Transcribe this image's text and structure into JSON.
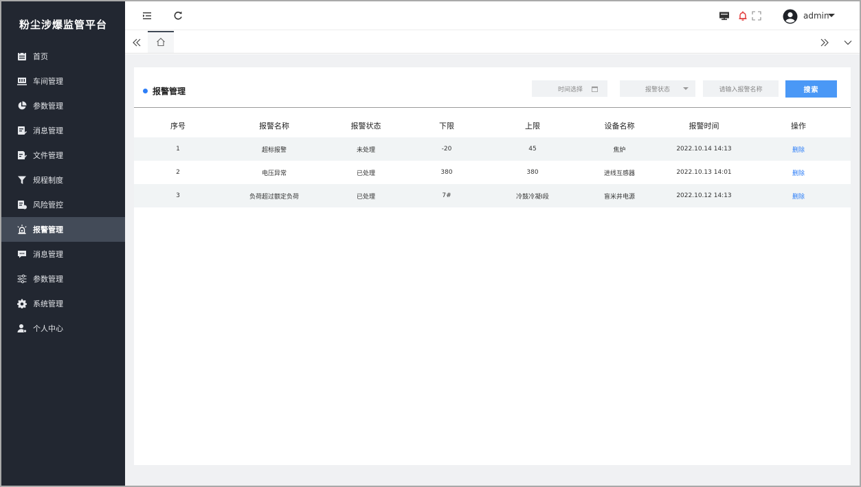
{
  "app": {
    "title": "粉尘涉爆监管平台"
  },
  "sidebar": {
    "items": [
      {
        "label": "首页",
        "icon": "calendar-icon",
        "active": false
      },
      {
        "label": "车间管理",
        "icon": "workshop-icon",
        "active": false
      },
      {
        "label": "参数管理",
        "icon": "pie-chart-icon",
        "active": false
      },
      {
        "label": "消息管理",
        "icon": "message-edit-icon",
        "active": false
      },
      {
        "label": "文件管理",
        "icon": "file-edit-icon",
        "active": false
      },
      {
        "label": "规程制度",
        "icon": "filter-icon",
        "active": false
      },
      {
        "label": "风险管控",
        "icon": "risk-doc-icon",
        "active": false
      },
      {
        "label": "报警管理",
        "icon": "alarm-icon",
        "active": true
      },
      {
        "label": "消息管理",
        "icon": "chat-icon",
        "active": false
      },
      {
        "label": "参数管理",
        "icon": "sliders-icon",
        "active": false
      },
      {
        "label": "系统管理",
        "icon": "gear-icon",
        "active": false
      },
      {
        "label": "个人中心",
        "icon": "user-icon",
        "active": false
      }
    ]
  },
  "header": {
    "icons": [
      "menu-fold-icon",
      "refresh-icon",
      "screen-icon",
      "bell-icon",
      "fullscreen-icon",
      "avatar-icon"
    ],
    "username": "admin"
  },
  "tabs": {
    "icons": [
      "double-left-icon",
      "home-icon",
      "double-right-icon",
      "chevron-down-icon"
    ]
  },
  "main": {
    "title": "报警管理",
    "filters": {
      "time_placeholder": "时间选择",
      "status_placeholder": "报警状态",
      "name_placeholder": "请输入报警名称",
      "search_label": "搜索"
    },
    "table": {
      "headers": [
        "序号",
        "报警名称",
        "报警状态",
        "下限",
        "上限",
        "设备名称",
        "报警时间",
        "操作"
      ],
      "rows": [
        {
          "index": "1",
          "name": "超标报警",
          "status": "未处理",
          "lower": "-20",
          "upper": "45",
          "device": "焦炉",
          "time": "2022.10.14  14:13",
          "action": "删除"
        },
        {
          "index": "2",
          "name": "电压异常",
          "status": "已处理",
          "lower": "380",
          "upper": "380",
          "device": "进线互感器",
          "time": "2022.10.13  14:01",
          "action": "删除"
        },
        {
          "index": "3",
          "name": "负荷超过额定负荷",
          "status": "已处理",
          "lower": "7#",
          "upper": "冷鼓冷凝I段",
          "device": "盲米井电源",
          "time": "2022.10.12  14:13",
          "action": "删除"
        }
      ]
    }
  },
  "colors": {
    "sidebar_bg": "#222731",
    "sidebar_active": "#434b58",
    "accent": "#2d7ef7",
    "search_button": "#4a98f6",
    "bell": "#e23b3b"
  }
}
